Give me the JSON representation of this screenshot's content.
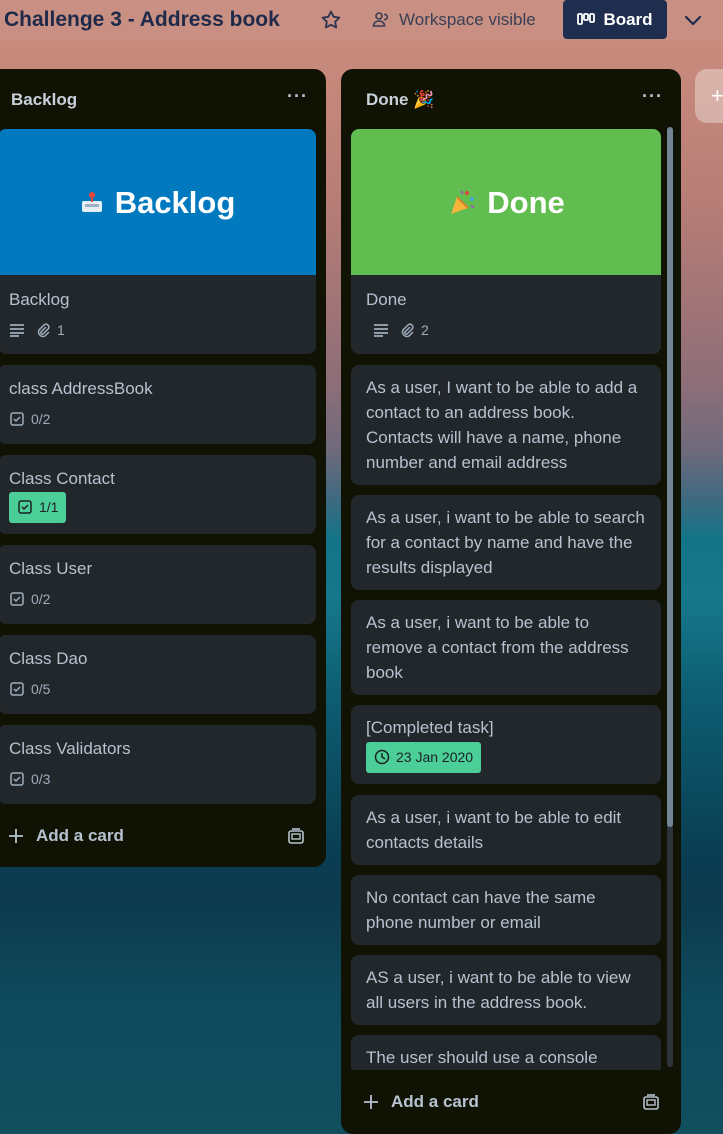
{
  "header": {
    "board_title": "Challenge 3 - Address book",
    "visibility_label": "Workspace visible",
    "board_view_label": "Board"
  },
  "lists": {
    "backlog": {
      "title": "Backlog",
      "cover_title": "Backlog",
      "cover_color": "#0079bf",
      "cards": [
        {
          "title": "Backlog",
          "attachments": "1"
        },
        {
          "title": "class AddressBook",
          "checklist": "0/2"
        },
        {
          "title": "Class Contact",
          "checklist": "1/1"
        },
        {
          "title": "Class User",
          "checklist": "0/2"
        },
        {
          "title": "Class Dao",
          "checklist": "0/5"
        },
        {
          "title": "Class Validators",
          "checklist": "0/3"
        }
      ],
      "add_card_label": "Add a card"
    },
    "done": {
      "title": "Done 🎉",
      "cover_title": "Done",
      "cover_color": "#61bd4f",
      "cards": [
        {
          "title": "Done",
          "attachments": "2"
        },
        {
          "title": "As a user, I want to be able to add a contact to an address book. Contacts will have a name, phone number and email address"
        },
        {
          "title": "As a user, i want to be able to search for a contact by name and have the results displayed"
        },
        {
          "title": "As a user, i want to be able to remove a contact from the address book"
        },
        {
          "title": "[Completed task]",
          "due": "23 Jan 2020"
        },
        {
          "title": "As a user, i want to be able to edit contacts details"
        },
        {
          "title": "No contact can have the same phone number or email"
        },
        {
          "title": "AS a user, i want to be able to view all users in the address book."
        },
        {
          "title": "The user should use a console"
        }
      ],
      "add_card_label": "Add a card"
    }
  },
  "colors": {
    "list_bg": "#101204",
    "card_bg": "#22272b",
    "complete_green": "#4bce97",
    "board_button": "#1f2e4f"
  }
}
